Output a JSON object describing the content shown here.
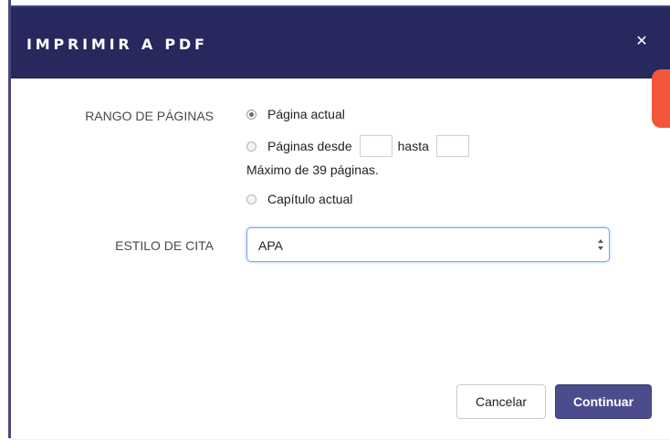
{
  "dialog": {
    "title": "IMPRIMIR A PDF",
    "close_icon": "close-icon"
  },
  "page_range": {
    "label": "RANGO DE PÁGINAS",
    "option_current_page": "Página actual",
    "option_pages_from": "Páginas desde",
    "to_label": "hasta",
    "from_value": "",
    "to_value": "",
    "max_note": "Máximo de 39 páginas.",
    "option_current_chapter": "Capítulo actual",
    "selected": "Página actual"
  },
  "citation_style": {
    "label": "ESTILO DE CITA",
    "selected": "APA"
  },
  "buttons": {
    "cancel": "Cancelar",
    "continue": "Continuar"
  },
  "colors": {
    "header": "#26285e",
    "primary_button": "#4b4c8c",
    "side_tab": "#f2573a",
    "focus_border": "#7aa6e8"
  }
}
